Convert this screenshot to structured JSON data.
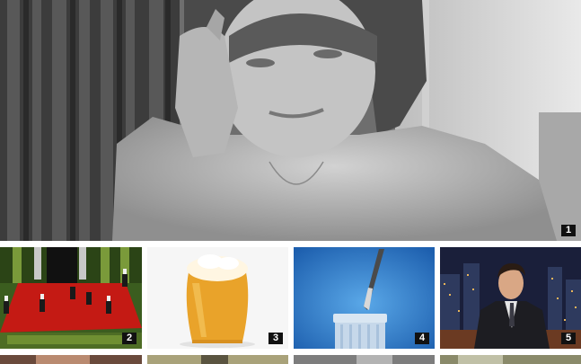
{
  "gallery": {
    "hero": {
      "rank": "1",
      "image": "portrait-photo"
    },
    "row": [
      {
        "rank": "2",
        "image": "retro-game-screenshot"
      },
      {
        "rank": "3",
        "image": "beer-glass-photo"
      },
      {
        "rank": "4",
        "image": "knife-column-photo"
      },
      {
        "rank": "5",
        "image": "talk-show-host-photo"
      }
    ],
    "next_row": [
      {
        "image": "thumbnail-6"
      },
      {
        "image": "thumbnail-7"
      },
      {
        "image": "thumbnail-8"
      },
      {
        "image": "thumbnail-9"
      }
    ]
  },
  "colors": {
    "badge_bg": "#111111",
    "badge_text": "#ffffff",
    "page_bg": "#ffffff"
  }
}
